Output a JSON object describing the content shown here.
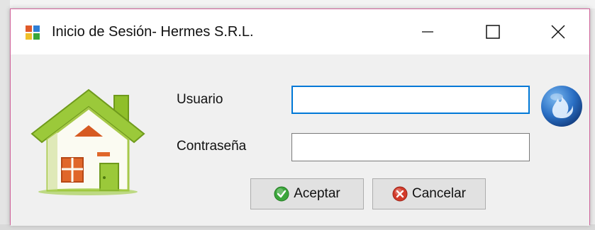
{
  "window": {
    "title": "Inicio de Sesión- Hermes S.R.L.",
    "border_color": "#d0629a"
  },
  "titlebar_buttons": {
    "minimize_icon": "minimize-icon",
    "maximize_icon": "maximize-icon",
    "close_icon": "close-icon"
  },
  "form": {
    "user_label": "Usuario",
    "user_value": "",
    "password_label": "Contraseña",
    "password_value": ""
  },
  "buttons": {
    "accept_label": "Aceptar",
    "accept_icon": "check-icon",
    "cancel_label": "Cancelar",
    "cancel_icon": "cancel-icon"
  },
  "images": {
    "house": "house-icon",
    "globe": "globe-icon"
  },
  "colors": {
    "focus_border": "#0078d7",
    "check_green": "#3aa63a",
    "cancel_red": "#d23a2a"
  }
}
